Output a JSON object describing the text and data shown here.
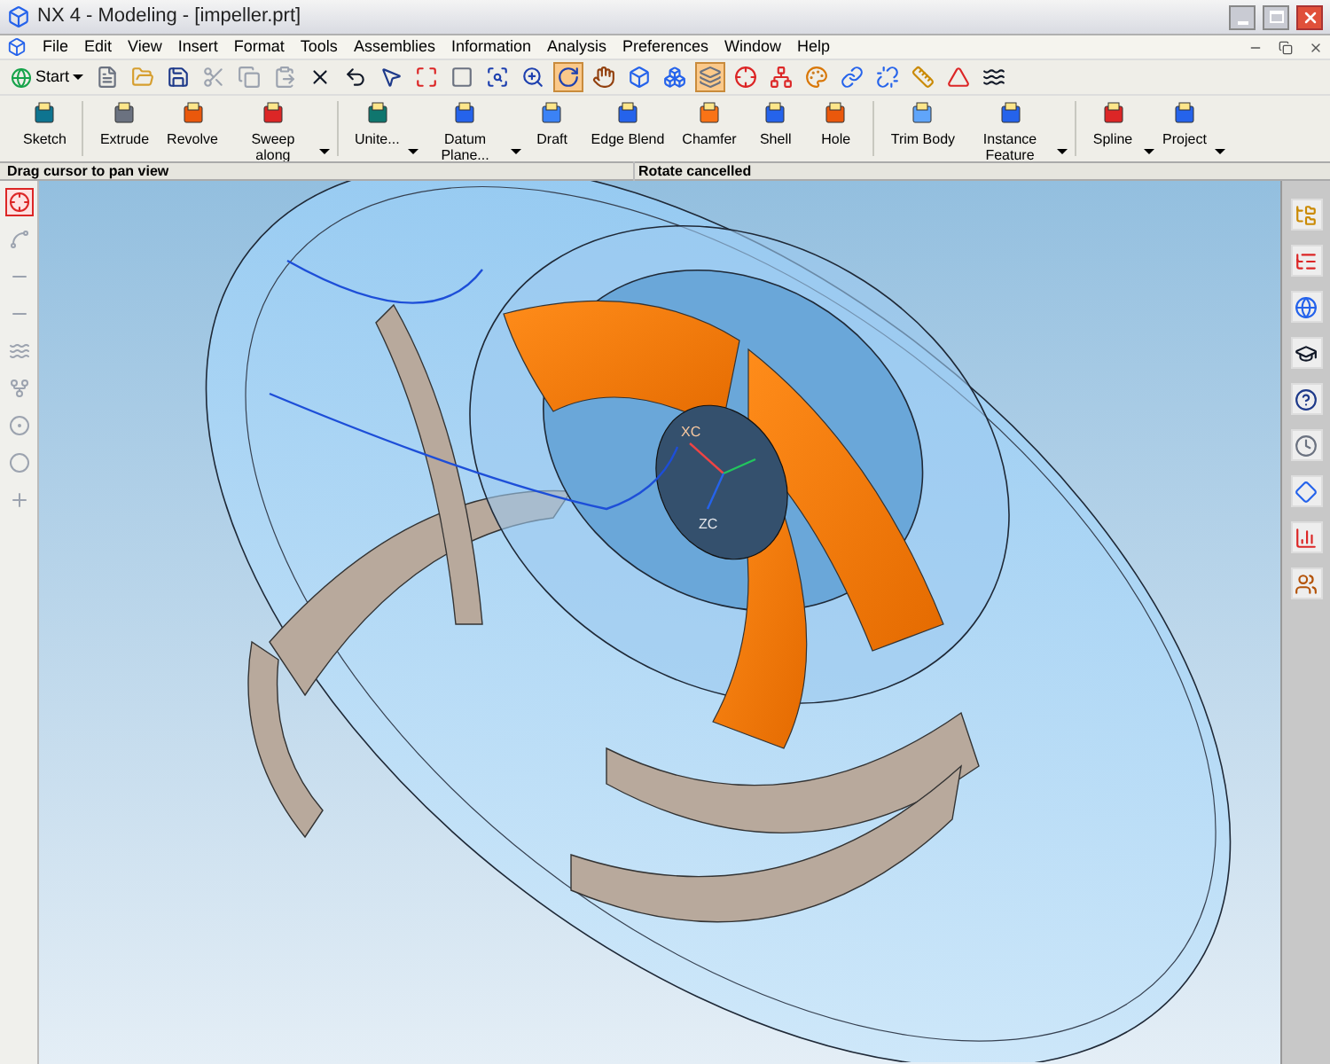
{
  "window": {
    "title": "NX 4 - Modeling - [impeller.prt]"
  },
  "menu": [
    "File",
    "Edit",
    "View",
    "Insert",
    "Format",
    "Tools",
    "Assemblies",
    "Information",
    "Analysis",
    "Preferences",
    "Window",
    "Help"
  ],
  "start_button": {
    "label": "Start"
  },
  "standard_toolbar": [
    {
      "pressed": false
    },
    {
      "pressed": false
    },
    {
      "pressed": false
    },
    {
      "pressed": false
    },
    {
      "pressed": false
    },
    {
      "pressed": false
    },
    {
      "pressed": false
    },
    {
      "pressed": false
    },
    {
      "pressed": false
    },
    {
      "pressed": false
    },
    {
      "pressed": false
    },
    {
      "pressed": false
    },
    {
      "pressed": false
    },
    {
      "pressed": true
    },
    {
      "pressed": false
    },
    {
      "pressed": false
    },
    {
      "pressed": false
    },
    {
      "pressed": true
    },
    {
      "pressed": false
    },
    {
      "pressed": false
    },
    {
      "pressed": false
    },
    {
      "pressed": false
    },
    {
      "pressed": false
    },
    {
      "pressed": false
    },
    {
      "pressed": false
    },
    {
      "pressed": false
    }
  ],
  "feature_toolbar": [
    {
      "label": "Sketch",
      "dropdown": false,
      "group_end": true
    },
    {
      "label": "Extrude",
      "dropdown": false,
      "group_end": false
    },
    {
      "label": "Revolve",
      "dropdown": false,
      "group_end": false
    },
    {
      "label": "Sweep along",
      "dropdown": true,
      "group_end": true
    },
    {
      "label": "Unite...",
      "dropdown": true,
      "group_end": false
    },
    {
      "label": "Datum Plane...",
      "dropdown": true,
      "group_end": false
    },
    {
      "label": "Draft",
      "dropdown": false,
      "group_end": false
    },
    {
      "label": "Edge Blend",
      "dropdown": false,
      "group_end": false
    },
    {
      "label": "Chamfer",
      "dropdown": false,
      "group_end": false
    },
    {
      "label": "Shell",
      "dropdown": false,
      "group_end": false
    },
    {
      "label": "Hole",
      "dropdown": false,
      "group_end": true
    },
    {
      "label": "Trim Body",
      "dropdown": false,
      "group_end": false
    },
    {
      "label": "Instance Feature",
      "dropdown": true,
      "group_end": true
    },
    {
      "label": "Spline",
      "dropdown": true,
      "group_end": false
    },
    {
      "label": "Project",
      "dropdown": true,
      "group_end": false
    }
  ],
  "status_bar": {
    "prompt": "Drag cursor to pan view",
    "message": "Rotate cancelled"
  },
  "left_toolbar": [
    {
      "pressed": true
    },
    {
      "pressed": false
    },
    {
      "pressed": false
    },
    {
      "pressed": false
    },
    {
      "pressed": false
    },
    {
      "pressed": false
    },
    {
      "pressed": false
    },
    {
      "pressed": false
    },
    {
      "pressed": false
    }
  ],
  "viewport": {
    "axis_labels": [
      "XC",
      "ZC"
    ]
  },
  "resource_bar": [
    {
      "pressed": false
    },
    {
      "pressed": false
    },
    {
      "pressed": false
    },
    {
      "pressed": false
    },
    {
      "pressed": false
    },
    {
      "pressed": false
    },
    {
      "pressed": false
    },
    {
      "pressed": false
    },
    {
      "pressed": false
    }
  ]
}
